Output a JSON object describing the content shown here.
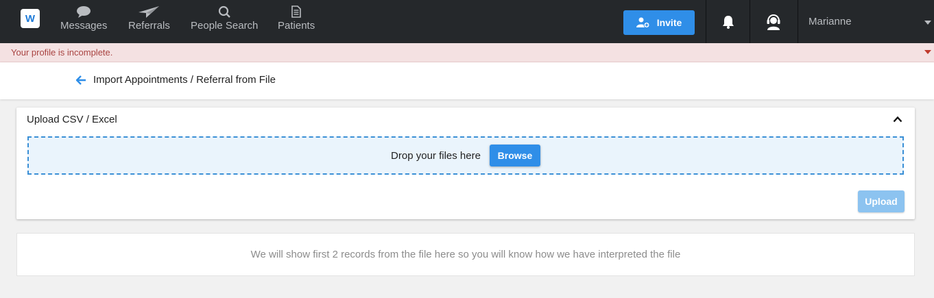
{
  "nav": {
    "logo_text": "W",
    "items": [
      {
        "label": "Messages",
        "icon": "chat-bubble-icon"
      },
      {
        "label": "Referrals",
        "icon": "paper-plane-icon"
      },
      {
        "label": "People Search",
        "icon": "search-icon"
      },
      {
        "label": "Patients",
        "icon": "document-icon"
      }
    ],
    "invite_label": "Invite",
    "user_name": "Marianne"
  },
  "alert": {
    "text": "Your profile is incomplete."
  },
  "page": {
    "title": "Import Appointments / Referral from File"
  },
  "upload_card": {
    "title": "Upload CSV / Excel",
    "drop_text": "Drop your files here",
    "browse_label": "Browse",
    "upload_label": "Upload"
  },
  "preview": {
    "text": "We will show first 2 records from the file here so you will know how we have interpreted the file"
  },
  "colors": {
    "nav_bg": "#25282b",
    "accent": "#2f8ee8",
    "alert_bg": "#f4e1e2",
    "alert_text": "#a94442",
    "upload_disabled": "#8cc3f0"
  }
}
